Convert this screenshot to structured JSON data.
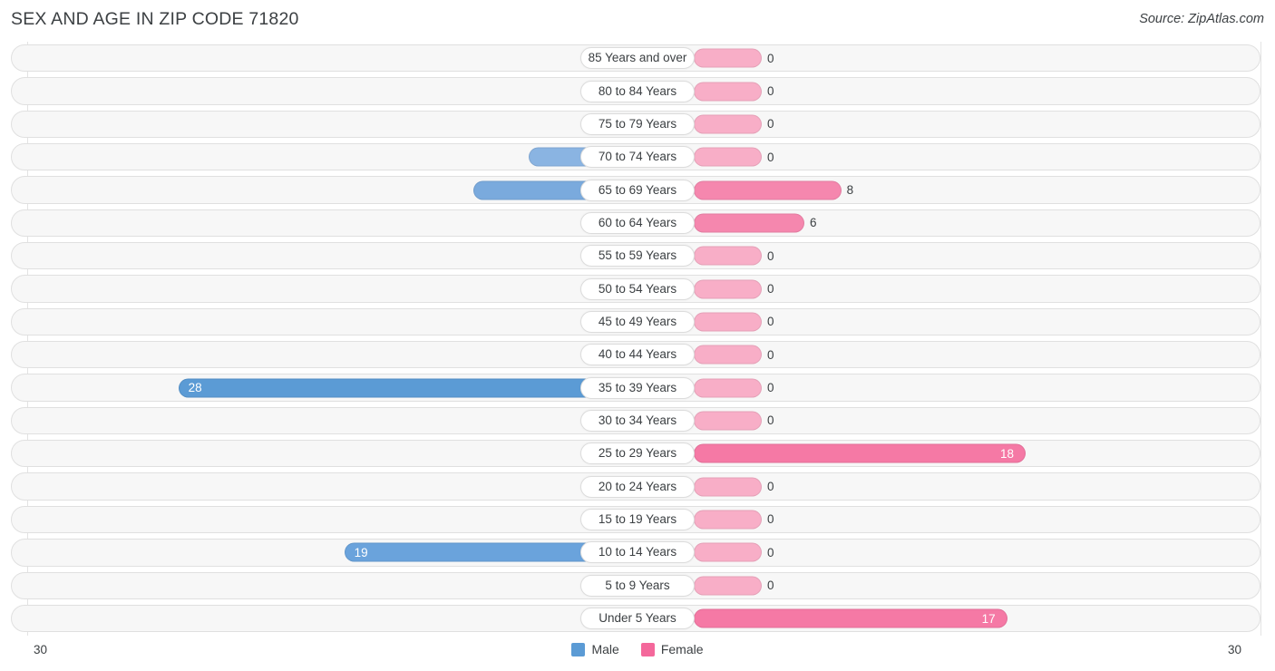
{
  "header": {
    "title": "SEX AND AGE IN ZIP CODE 71820",
    "source": "Source: ZipAtlas.com"
  },
  "legend": {
    "male_label": "Male",
    "female_label": "Female",
    "male_color": "#5b9bd5",
    "female_color": "#f4689b"
  },
  "axis": {
    "left_max": "30",
    "right_max": "30"
  },
  "chart_data": {
    "type": "bar",
    "subtype": "population-pyramid",
    "title": "SEX AND AGE IN ZIP CODE 71820",
    "xlabel": "",
    "ylabel": "",
    "xlim": [
      30,
      30
    ],
    "grid": true,
    "legend_position": "bottom-center",
    "categories": [
      "85 Years and over",
      "80 to 84 Years",
      "75 to 79 Years",
      "70 to 74 Years",
      "65 to 69 Years",
      "60 to 64 Years",
      "55 to 59 Years",
      "50 to 54 Years",
      "45 to 49 Years",
      "40 to 44 Years",
      "35 to 39 Years",
      "30 to 34 Years",
      "25 to 29 Years",
      "20 to 24 Years",
      "15 to 19 Years",
      "10 to 14 Years",
      "5 to 9 Years",
      "Under 5 Years"
    ],
    "series": [
      {
        "name": "Male",
        "values": [
          0,
          0,
          0,
          9,
          12,
          0,
          0,
          0,
          0,
          0,
          28,
          0,
          0,
          0,
          0,
          19,
          0,
          0
        ]
      },
      {
        "name": "Female",
        "values": [
          0,
          0,
          0,
          0,
          8,
          6,
          0,
          0,
          0,
          0,
          0,
          0,
          18,
          0,
          0,
          0,
          0,
          17
        ]
      }
    ]
  },
  "rows": [
    {
      "label": "85 Years and over",
      "male": "0",
      "female": "0"
    },
    {
      "label": "80 to 84 Years",
      "male": "0",
      "female": "0"
    },
    {
      "label": "75 to 79 Years",
      "male": "0",
      "female": "0"
    },
    {
      "label": "70 to 74 Years",
      "male": "9",
      "female": "0"
    },
    {
      "label": "65 to 69 Years",
      "male": "12",
      "female": "8"
    },
    {
      "label": "60 to 64 Years",
      "male": "0",
      "female": "6"
    },
    {
      "label": "55 to 59 Years",
      "male": "0",
      "female": "0"
    },
    {
      "label": "50 to 54 Years",
      "male": "0",
      "female": "0"
    },
    {
      "label": "45 to 49 Years",
      "male": "0",
      "female": "0"
    },
    {
      "label": "40 to 44 Years",
      "male": "0",
      "female": "0"
    },
    {
      "label": "35 to 39 Years",
      "male": "28",
      "female": "0"
    },
    {
      "label": "30 to 34 Years",
      "male": "0",
      "female": "0"
    },
    {
      "label": "25 to 29 Years",
      "male": "0",
      "female": "18"
    },
    {
      "label": "20 to 24 Years",
      "male": "0",
      "female": "0"
    },
    {
      "label": "15 to 19 Years",
      "male": "0",
      "female": "0"
    },
    {
      "label": "10 to 14 Years",
      "male": "19",
      "female": "0"
    },
    {
      "label": "5 to 9 Years",
      "male": "0",
      "female": "0"
    },
    {
      "label": "Under 5 Years",
      "male": "0",
      "female": "17"
    }
  ]
}
